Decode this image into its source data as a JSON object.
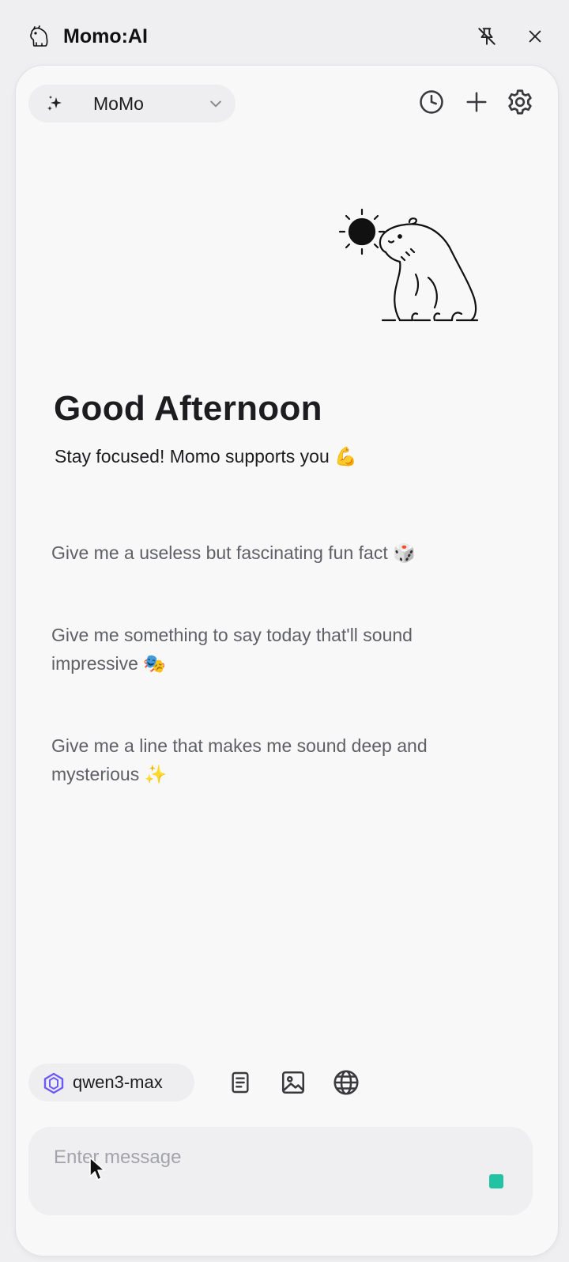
{
  "app": {
    "title": "Momo:AI"
  },
  "header": {
    "agent_label": "MoMo"
  },
  "welcome": {
    "greeting": "Good Afternoon",
    "subtitle": "Stay focused! Momo supports you 💪"
  },
  "suggestions": [
    {
      "text": "Give me a useless but fascinating fun fact 🎲"
    },
    {
      "text": "Give me something to say today that'll sound impressive 🎭"
    },
    {
      "text": "Give me a line that makes me sound deep and mysterious ✨"
    }
  ],
  "toolbar": {
    "model_label": "qwen3-max"
  },
  "composer": {
    "placeholder": "Enter message"
  },
  "colors": {
    "accent": "#22c3a2",
    "model_icon": "#6b5bf3"
  }
}
